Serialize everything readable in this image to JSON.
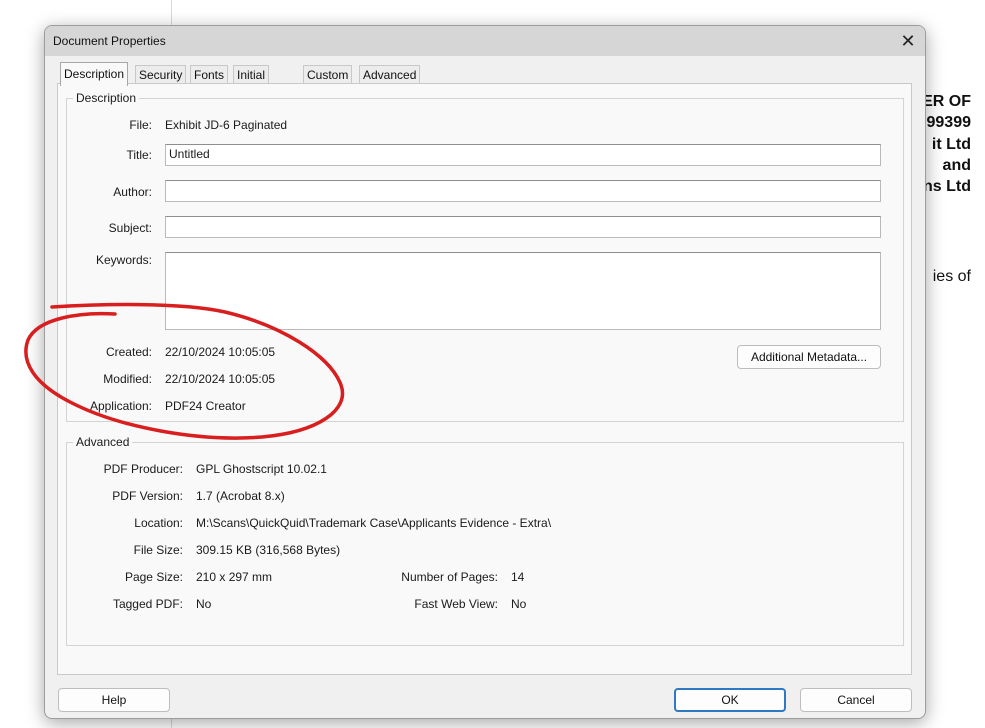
{
  "background": {
    "lines": [
      {
        "text": "ER OF",
        "bold": true
      },
      {
        "text": "99399",
        "bold": true
      },
      {
        "text": "it Ltd",
        "bold": true
      },
      {
        "text": "and",
        "bold": true
      },
      {
        "text": "ns Ltd",
        "bold": true
      },
      {
        "text": "ies of",
        "bold": false
      }
    ]
  },
  "dialog": {
    "title": "Document Properties",
    "close_icon": "close-icon"
  },
  "tabs": [
    "Description",
    "Security",
    "Fonts",
    "Initial View",
    "Custom",
    "Advanced"
  ],
  "active_tab": "Description",
  "description": {
    "group_title": "Description",
    "file_label": "File:",
    "file_value": "Exhibit JD-6 Paginated",
    "title_label": "Title:",
    "title_value": "Untitled",
    "author_label": "Author:",
    "author_value": "",
    "subject_label": "Subject:",
    "subject_value": "",
    "keywords_label": "Keywords:",
    "keywords_value": "",
    "created_label": "Created:",
    "created_value": "22/10/2024 10:05:05",
    "modified_label": "Modified:",
    "modified_value": "22/10/2024 10:05:05",
    "application_label": "Application:",
    "application_value": "PDF24 Creator",
    "additional_metadata_button": "Additional Metadata..."
  },
  "advanced": {
    "group_title": "Advanced",
    "pdf_producer_label": "PDF Producer:",
    "pdf_producer_value": "GPL Ghostscript 10.02.1",
    "pdf_version_label": "PDF Version:",
    "pdf_version_value": "1.7 (Acrobat 8.x)",
    "location_label": "Location:",
    "location_value": "M:\\Scans\\QuickQuid\\Trademark Case\\Applicants Evidence - Extra\\",
    "file_size_label": "File Size:",
    "file_size_value": "309.15 KB (316,568 Bytes)",
    "page_size_label": "Page Size:",
    "page_size_value": "210 x 297 mm",
    "num_pages_label": "Number of Pages:",
    "num_pages_value": "14",
    "tagged_pdf_label": "Tagged PDF:",
    "tagged_pdf_value": "No",
    "fast_web_view_label": "Fast Web View:",
    "fast_web_view_value": "No"
  },
  "buttons": {
    "help": "Help",
    "ok": "OK",
    "cancel": "Cancel"
  },
  "annotation": {
    "color": "#d81e1e"
  }
}
